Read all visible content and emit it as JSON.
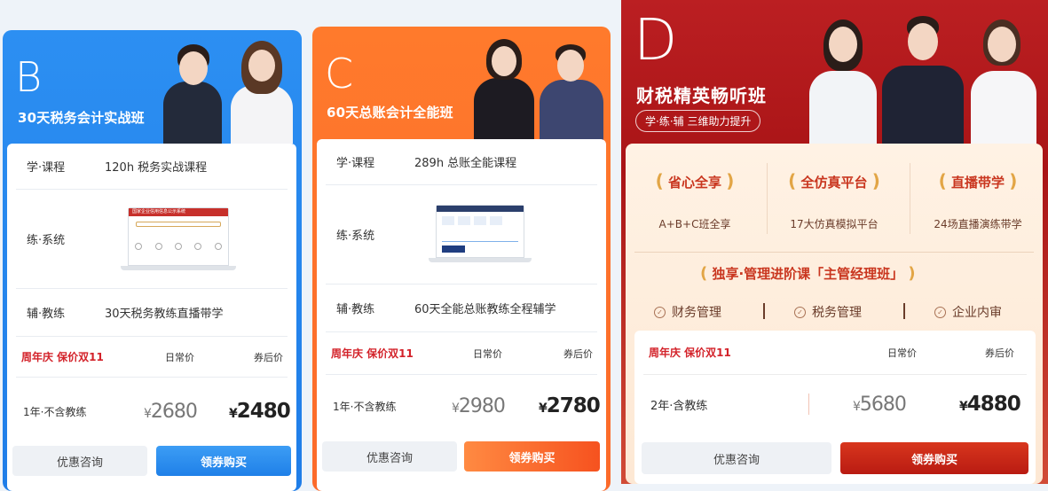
{
  "cards": {
    "b": {
      "letter": "B",
      "title": "30天税务会计实战班",
      "rows": [
        {
          "label": "学·课程",
          "value": "120h 税务实战课程"
        },
        {
          "label": "练·系统",
          "value": ""
        },
        {
          "label": "辅·教练",
          "value": "30天税务教练直播带学"
        }
      ],
      "system_image_title": "国家企业信用信息公示系统",
      "promo": "周年庆 保价双11",
      "col_regular": "日常价",
      "col_after": "券后价",
      "plan": "1年·不含教练",
      "regular_price": "2680",
      "after_price": "2480",
      "consult_label": "优惠咨询",
      "buy_label": "领券购买"
    },
    "c": {
      "letter": "C",
      "title": "60天总账会计全能班",
      "rows": [
        {
          "label": "学·课程",
          "value": "289h 总账全能课程"
        },
        {
          "label": "练·系统",
          "value": ""
        },
        {
          "label": "辅·教练",
          "value": "60天全能总账教练全程辅学"
        }
      ],
      "promo": "周年庆 保价双11",
      "col_regular": "日常价",
      "col_after": "券后价",
      "plan": "1年·不含教练",
      "regular_price": "2980",
      "after_price": "2780",
      "consult_label": "优惠咨询",
      "buy_label": "领券购买"
    },
    "d": {
      "letter": "D",
      "title": "财税精英畅听班",
      "subtitle": "学·练·辅 三维助力提升",
      "features": [
        {
          "title": "省心全享",
          "desc": "A+B+C班全享"
        },
        {
          "title": "全仿真平台",
          "desc": "17大仿真模拟平台"
        },
        {
          "title": "直播带学",
          "desc": "24场直播演练带学"
        }
      ],
      "exclusive": "独享·管理进阶课「主管经理班」",
      "checks": [
        "财务管理",
        "税务管理",
        "企业内审"
      ],
      "promo": "周年庆 保价双11",
      "col_regular": "日常价",
      "col_after": "券后价",
      "plan": "2年·含教练",
      "regular_price": "5680",
      "after_price": "4880",
      "consult_label": "优惠咨询",
      "buy_label": "领券购买"
    }
  },
  "currency": "¥",
  "colors": {
    "blue": "#2a8cf0",
    "orange": "#ff6f2a",
    "red": "#b3191b",
    "promo_red": "#d3222a"
  }
}
